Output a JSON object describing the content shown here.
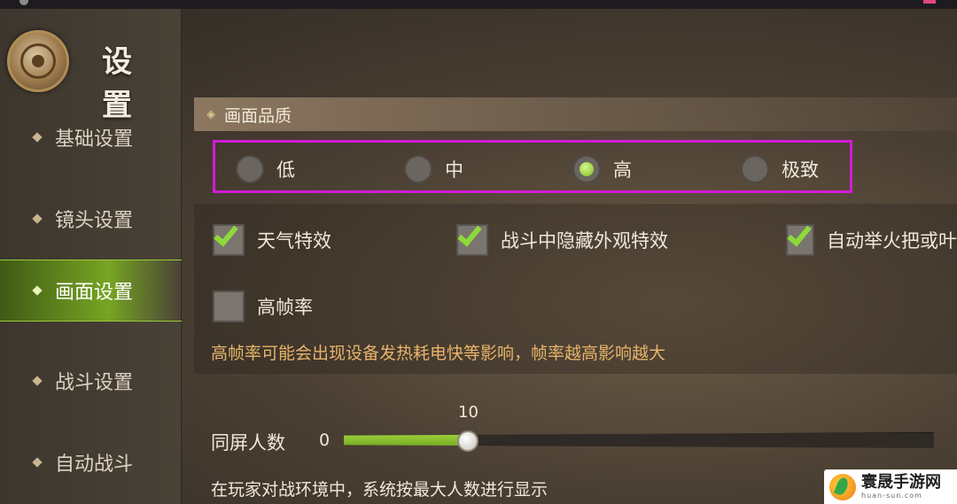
{
  "header": {
    "title": "设 置"
  },
  "sidebar": {
    "items": [
      {
        "label": "基础设置",
        "active": false
      },
      {
        "label": "镜头设置",
        "active": false
      },
      {
        "label": "画面设置",
        "active": true
      },
      {
        "label": "战斗设置",
        "active": false
      },
      {
        "label": "自动战斗",
        "active": false
      }
    ]
  },
  "quality": {
    "section_title": "画面品质",
    "options": [
      {
        "label": "低",
        "selected": false
      },
      {
        "label": "中",
        "selected": false
      },
      {
        "label": "高",
        "selected": true
      },
      {
        "label": "极致",
        "selected": false
      }
    ]
  },
  "effects": {
    "weather": {
      "label": "天气特效",
      "checked": true
    },
    "hide_battle": {
      "label": "战斗中隐藏外观特效",
      "checked": true
    },
    "auto_torch": {
      "label": "自动举火把或叶",
      "checked": true
    },
    "high_fps": {
      "label": "高帧率",
      "checked": false
    },
    "high_fps_note": "高帧率可能会出现设备发热耗电快等影响，帧率越高影响越大"
  },
  "players": {
    "label": "同屏人数",
    "min": "0",
    "value": "10",
    "fill_fraction": 0.21,
    "note": "在玩家对战环境中，系统按最大人数进行显示"
  },
  "watermark": {
    "main": "寰晟手游网",
    "sub": "huan-sun.com"
  },
  "colors": {
    "accent": "#77a523",
    "highlight_box": "#d31ad7",
    "note": "#e8b46a"
  }
}
